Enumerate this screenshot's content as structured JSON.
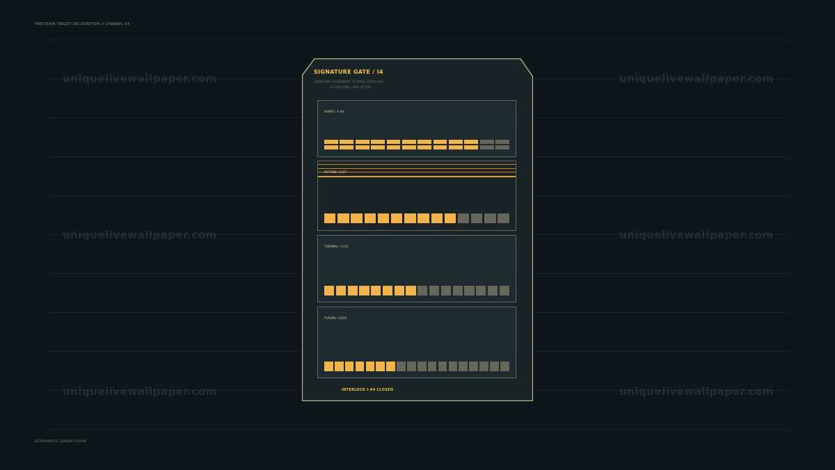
{
  "header": {
    "label": "PRECISION TARGET RECOGNITION // CHANNEL 64"
  },
  "footer": {
    "label": "DETERMINISTIC SENSOR FUSION"
  },
  "watermark": {
    "text": "uniquelivewallpaper.com"
  },
  "card": {
    "title": "SIGNATURE GATE / I4",
    "subtitle_1": "SIGNATURE AGREEMENT TO MAKE INTERLOCK",
    "subtitle_2": "ACTIVATIONS · 88% ACTIVE",
    "panels": [
      {
        "label": "SHAPE / 0.94",
        "level": 10,
        "segments": 12,
        "style": "split"
      },
      {
        "label": "MOTION / 0.87",
        "level": 10,
        "segments": 14,
        "style": "solid"
      },
      {
        "label": "THERMAL / 0.91",
        "level": 8,
        "segments": 16,
        "style": "solid"
      },
      {
        "label": "FUSION / LOCK",
        "level": 7,
        "segments": 18,
        "style": "solid"
      }
    ],
    "status": "INTERLOCK  I-44  CLOSED"
  },
  "colors": {
    "accent": "#f2b44a",
    "inactive": "#67665a",
    "frame": "#c9c19a",
    "background": "#0e1619"
  }
}
